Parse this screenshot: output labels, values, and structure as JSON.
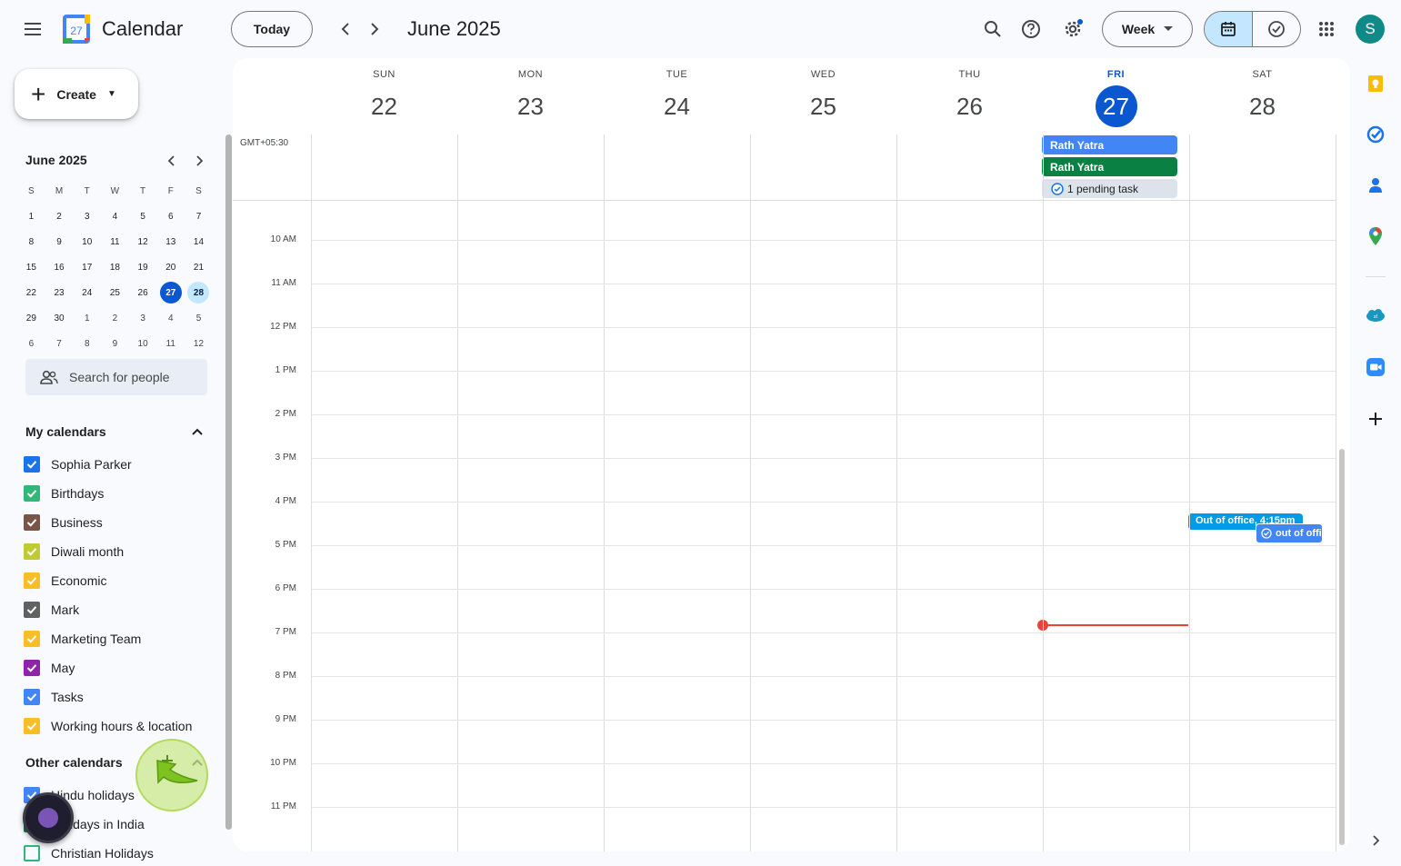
{
  "header": {
    "app_title": "Calendar",
    "logo_day": "27",
    "today_label": "Today",
    "period_title": "June 2025",
    "view_label": "Week",
    "avatar_letter": "S"
  },
  "create": {
    "label": "Create"
  },
  "mini_calendar": {
    "title": "June 2025",
    "dow": [
      "S",
      "M",
      "T",
      "W",
      "T",
      "F",
      "S"
    ],
    "weeks": [
      [
        "1",
        "2",
        "3",
        "4",
        "5",
        "6",
        "7"
      ],
      [
        "8",
        "9",
        "10",
        "11",
        "12",
        "13",
        "14"
      ],
      [
        "15",
        "16",
        "17",
        "18",
        "19",
        "20",
        "21"
      ],
      [
        "22",
        "23",
        "24",
        "25",
        "26",
        "27",
        "28"
      ],
      [
        "29",
        "30",
        "1",
        "2",
        "3",
        "4",
        "5"
      ],
      [
        "6",
        "7",
        "8",
        "9",
        "10",
        "11",
        "12"
      ]
    ],
    "today": "27",
    "selected": "28"
  },
  "people_search": {
    "placeholder": "Search for people"
  },
  "my_calendars": {
    "title": "My calendars",
    "items": [
      {
        "label": "Sophia Parker",
        "color": "#1a73e8",
        "checked": true
      },
      {
        "label": "Birthdays",
        "color": "#33b679",
        "checked": true
      },
      {
        "label": "Business",
        "color": "#795548",
        "checked": true
      },
      {
        "label": "Diwali month",
        "color": "#c0ca33",
        "checked": true
      },
      {
        "label": "Economic",
        "color": "#f6bf26",
        "checked": true
      },
      {
        "label": "Mark",
        "color": "#616161",
        "checked": true
      },
      {
        "label": "Marketing Team",
        "color": "#f6bf26",
        "checked": true
      },
      {
        "label": "May",
        "color": "#8e24aa",
        "checked": true
      },
      {
        "label": "Tasks",
        "color": "#4285f4",
        "checked": true
      },
      {
        "label": "Working hours & location",
        "color": "#f6bf26",
        "checked": true
      }
    ]
  },
  "other_calendars": {
    "title": "Other calendars",
    "items": [
      {
        "label": "Hindu holidays",
        "color": "#4285f4",
        "checked": true
      },
      {
        "label": "Holidays in India",
        "color": "#0b8043",
        "checked": true
      },
      {
        "label": "Christian Holidays",
        "color": "#33b679",
        "checked": false
      }
    ]
  },
  "week": {
    "timezone": "GMT+05:30",
    "days": [
      {
        "dow": "SUN",
        "num": "22"
      },
      {
        "dow": "MON",
        "num": "23"
      },
      {
        "dow": "TUE",
        "num": "24"
      },
      {
        "dow": "WED",
        "num": "25"
      },
      {
        "dow": "THU",
        "num": "26"
      },
      {
        "dow": "FRI",
        "num": "27",
        "today": true
      },
      {
        "dow": "SAT",
        "num": "28"
      }
    ],
    "hours": [
      "10 AM",
      "11 AM",
      "12 PM",
      "1 PM",
      "2 PM",
      "3 PM",
      "4 PM",
      "5 PM",
      "6 PM",
      "7 PM",
      "8 PM",
      "9 PM",
      "10 PM",
      "11 PM"
    ],
    "all_day": [
      {
        "label": "Rath Yatra",
        "color": "#4285f4"
      },
      {
        "label": "Rath Yatra",
        "color": "#0b8043"
      },
      {
        "label": "1 pending task",
        "color": "#dde3ea"
      }
    ],
    "events": [
      {
        "label": "Out of office, 4:15pm",
        "color": "#039be5"
      },
      {
        "label": "out of office",
        "color": "#4285f4"
      }
    ]
  },
  "colors": {
    "accent": "#0b57d0",
    "now_indicator": "#ea4335"
  }
}
